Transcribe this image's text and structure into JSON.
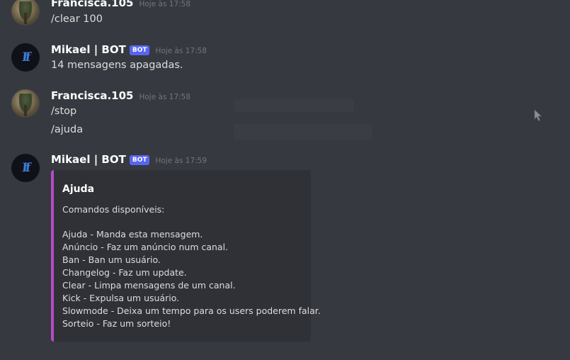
{
  "messages": [
    {
      "author": "Francisca.105",
      "timestamp": "Hoje às 17:58",
      "lines": [
        "/clear 100"
      ]
    },
    {
      "author": "Mikael | BOT",
      "bot_tag": "BOT",
      "timestamp": "Hoje às 17:58",
      "lines": [
        "14 mensagens apagadas."
      ]
    },
    {
      "author": "Francisca.105",
      "timestamp": "Hoje às 17:58",
      "lines": [
        "/stop",
        "/ajuda"
      ]
    },
    {
      "author": "Mikael | BOT",
      "bot_tag": "BOT",
      "timestamp": "Hoje às 17:59",
      "embed": {
        "accent_color": "#b54cc8",
        "title": "Ajuda",
        "description": "Comandos disponíveis:",
        "commands": [
          "Ajuda - Manda esta mensagem.",
          "Anúncio - Faz um anúncio num canal.",
          "Ban - Ban um usuário.",
          "Changelog - Faz um update.",
          "Clear - Limpa mensagens de um canal.",
          "Kick - Expulsa um usuário.",
          "Slowmode - Deixa um tempo para os users poderem falar.",
          "Sorteio - Faz um sorteio!"
        ]
      }
    }
  ],
  "colors": {
    "background": "#36393f",
    "embed_background": "#2f3136",
    "bot_tag": "#5865f2",
    "username": "#ffffff",
    "timestamp": "#72767d",
    "text": "#dcddde"
  },
  "bot_avatar_logo": "If"
}
